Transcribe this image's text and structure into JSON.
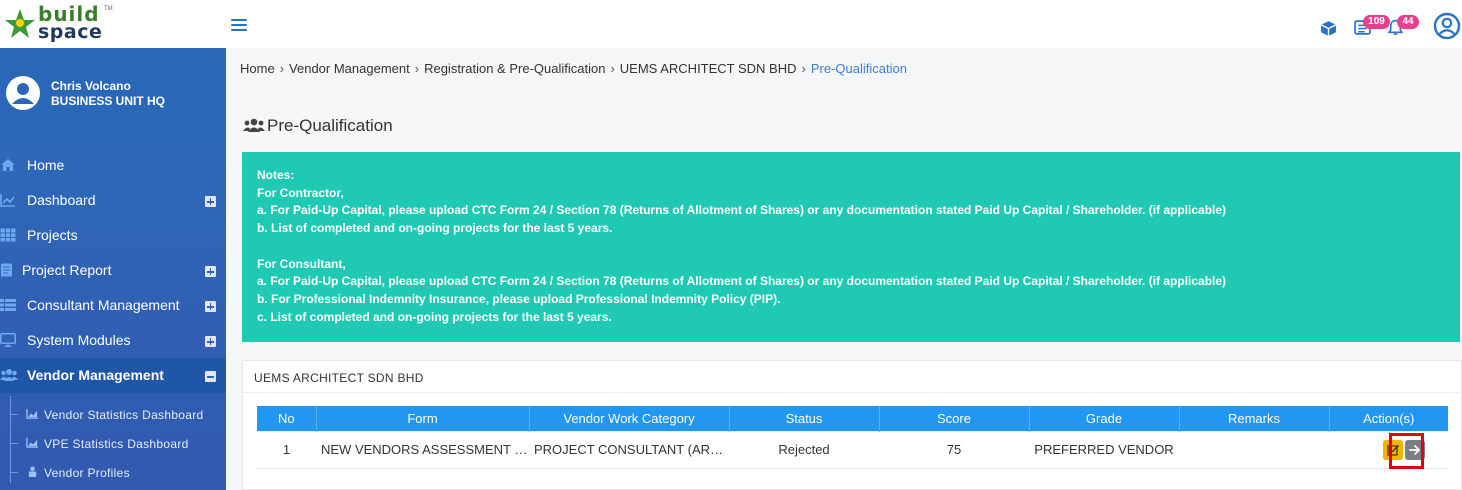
{
  "logo": {
    "line1": "build",
    "line2": "space",
    "tm": "TM"
  },
  "topbar": {
    "task_count": "109",
    "notification_count": "44",
    "colors": {
      "accent": "#2a72c4",
      "badge": "#e83e8c"
    }
  },
  "user": {
    "name": "Chris Volcano",
    "unit": "BUSINESS UNIT HQ"
  },
  "sidebar": {
    "items": [
      {
        "label": "Home",
        "icon": "home-icon"
      },
      {
        "label": "Dashboard",
        "icon": "chart-line-icon"
      },
      {
        "label": "Projects",
        "icon": "table-icon"
      },
      {
        "label": "Project Report",
        "icon": "report-icon"
      },
      {
        "label": "Consultant Management",
        "icon": "list-icon"
      },
      {
        "label": "System Modules",
        "icon": "monitor-icon"
      },
      {
        "label": "Vendor Management",
        "icon": "users-icon"
      }
    ],
    "subitems": [
      {
        "label": "Vendor Statistics Dashboard",
        "icon": "chart-area-icon"
      },
      {
        "label": "VPE Statistics Dashboard",
        "icon": "chart-area-icon"
      },
      {
        "label": "Vendor Profiles",
        "icon": "building-icon"
      }
    ]
  },
  "breadcrumb": {
    "items": [
      "Home",
      "Vendor Management",
      "Registration & Pre-Qualification",
      "UEMS ARCHITECT SDN BHD"
    ],
    "current": "Pre-Qualification"
  },
  "page": {
    "title": "Pre-Qualification"
  },
  "notes": {
    "lines": [
      "Notes:",
      "For Contractor,",
      "a. For Paid-Up Capital, please upload CTC Form 24 / Section 78 (Returns of Allotment of Shares) or any documentation stated Paid Up Capital / Shareholder. (if applicable)",
      "b. List of completed and on-going projects for the last 5 years.",
      "",
      "For Consultant,",
      "a. For Paid-Up Capital, please upload CTC Form 24 / Section 78 (Returns of Allotment of Shares) or any documentation stated Paid Up Capital / Shareholder. (if applicable)",
      "b. For Professional Indemnity Insurance, please upload Professional Indemnity Policy (PIP).",
      "c. List of completed and on-going projects for the last 5 years."
    ],
    "color": "#20c9b3"
  },
  "card": {
    "title": "UEMS ARCHITECT SDN BHD",
    "columns": [
      "No",
      "Form",
      "Vendor Work Category",
      "Status",
      "Score",
      "Grade",
      "Remarks",
      "Action(s)"
    ],
    "rows": [
      {
        "no": "1",
        "form": "NEW VENDORS ASSESSMENT FO...",
        "category": "PROJECT CONSULTANT (ARCH...",
        "status": "Rejected",
        "score": "75",
        "grade": "PREFERRED VENDOR",
        "remarks": ""
      }
    ],
    "header_color": "#2196f3"
  }
}
